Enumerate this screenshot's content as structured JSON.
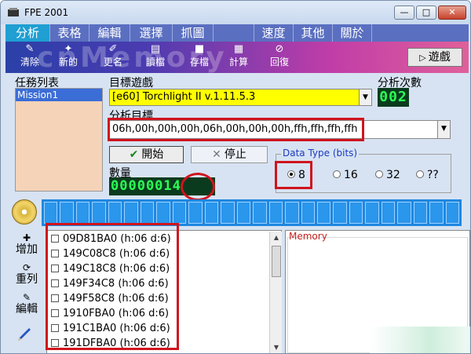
{
  "window": {
    "title": "FPE 2001",
    "min_glyph": "—",
    "max_glyph": "□",
    "close_glyph": "✕"
  },
  "menu": [
    {
      "label": "分析",
      "active": true
    },
    {
      "label": "表格"
    },
    {
      "label": "編輯"
    },
    {
      "label": "選擇"
    },
    {
      "label": "抓圖"
    },
    {
      "label": ""
    },
    {
      "label": "速度"
    },
    {
      "label": "其他"
    },
    {
      "label": "關於"
    }
  ],
  "toolbar": {
    "buttons": [
      {
        "label": "清除",
        "icon": "eraser-icon"
      },
      {
        "label": "新的",
        "icon": "new-icon"
      },
      {
        "label": "更名",
        "icon": "rename-icon"
      },
      {
        "label": "讀檔",
        "icon": "open-icon"
      },
      {
        "label": "存檔",
        "icon": "save-icon"
      },
      {
        "label": "計算",
        "icon": "calculator-icon"
      },
      {
        "label": "回復",
        "icon": "undo-icon"
      }
    ],
    "watermark": "cnMemory",
    "game_button": "遊戲"
  },
  "task_list": {
    "label": "任務列表",
    "items": [
      "Mission1"
    ]
  },
  "target_game": {
    "label": "目標遊戲",
    "value": "[e60] Torchlight II v.1.11.5.3"
  },
  "analysis_count": {
    "label": "分析次數",
    "value": "002"
  },
  "analysis_target": {
    "label": "分析目標",
    "value": "06h,00h,00h,00h,06h,00h,00h,00h,ffh,ffh,ffh,ffh"
  },
  "actions": {
    "start": "開始",
    "stop": "停止"
  },
  "quantity": {
    "label": "數量",
    "value": "00000014"
  },
  "data_type": {
    "legend": "Data Type (bits)",
    "options": [
      "8",
      "16",
      "32",
      "??"
    ],
    "selected": "8"
  },
  "side_buttons": [
    {
      "label": "增加",
      "icon": "add-icon"
    },
    {
      "label": "重列",
      "icon": "relist-icon"
    },
    {
      "label": "編輯",
      "icon": "edit-icon"
    }
  ],
  "results": [
    "09D81BA0 (h:06 d:6)",
    "149C08C8 (h:06 d:6)",
    "149C18C8 (h:06 d:6)",
    "149F34C8 (h:06 d:6)",
    "149F58C8 (h:06 d:6)",
    "1910FBA0 (h:06 d:6)",
    "191C1BA0 (h:06 d:6)",
    "191DFBA0 (h:06 d:6)"
  ],
  "memory_panel": {
    "legend": "Memory"
  },
  "colors": {
    "menubar": "#5a6fc0",
    "active_tab": "#1f9fd2",
    "highlight_red": "#d0141e",
    "game_field": "#ffff00",
    "seg_green": "#2bff55"
  }
}
